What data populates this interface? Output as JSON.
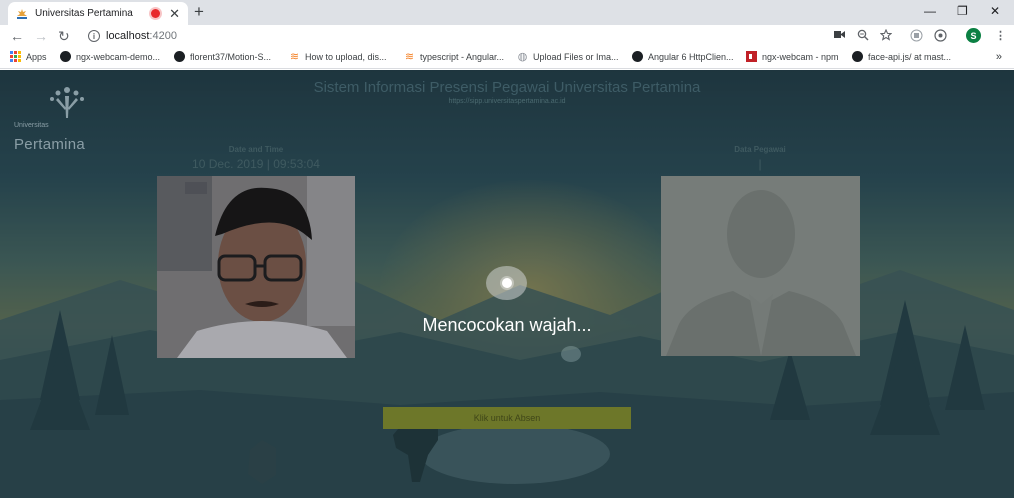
{
  "browser": {
    "tab_title": "Universitas Pertamina",
    "new_tab_symbol": "+",
    "tab_close_symbol": "✕",
    "window_controls": {
      "minimize": "—",
      "restore": "❐",
      "close": "✕"
    },
    "nav": {
      "back": "←",
      "forward": "→",
      "reload": "↻"
    },
    "url_host": "localhost",
    "url_port": ":4200",
    "avatar_letter": "S",
    "toolbar_icons": [
      "camera-icon",
      "zoom-icon",
      "star-icon",
      "extension-icon",
      "extension-icon",
      "menu-icon"
    ],
    "bookmarks": [
      {
        "icon": "apps-icon",
        "label": "Apps"
      },
      {
        "icon": "github-icon",
        "label": "ngx-webcam-demo..."
      },
      {
        "icon": "github-icon",
        "label": "florent37/Motion-S..."
      },
      {
        "icon": "stackoverflow-icon",
        "label": "How to upload, dis..."
      },
      {
        "icon": "stackoverflow-icon",
        "label": "typescript - Angular..."
      },
      {
        "icon": "globe-icon",
        "label": "Upload Files or Ima..."
      },
      {
        "icon": "medium-icon",
        "label": "Angular 6 HttpClien..."
      },
      {
        "icon": "npm-icon",
        "label": "ngx-webcam - npm"
      },
      {
        "icon": "github-icon",
        "label": "face-api.js/ at mast..."
      }
    ],
    "bookmarks_more": "»"
  },
  "app": {
    "logo_top": "Universitas",
    "logo_main": "Pertamina",
    "title": "Sistem Informasi Presensi Pegawai Universitas Pertamina",
    "subtitle": "https://sipp.universitaspertamina.ac.id",
    "datetime_label": "Date and Time",
    "datetime_value": "10 Dec. 2019 | 09:53:04",
    "employee_label": "Data Pegawai",
    "employee_value": "|",
    "submit_button": "Klik untuk Absen",
    "loading_text": "Mencocokan wajah..."
  },
  "colors": {
    "tabstrip": "#dee1e6",
    "recording": "#e8272a",
    "avatar": "#0b8043",
    "submit_button": "#6d7729",
    "overlay": "rgba(25,40,45,0.42)"
  }
}
